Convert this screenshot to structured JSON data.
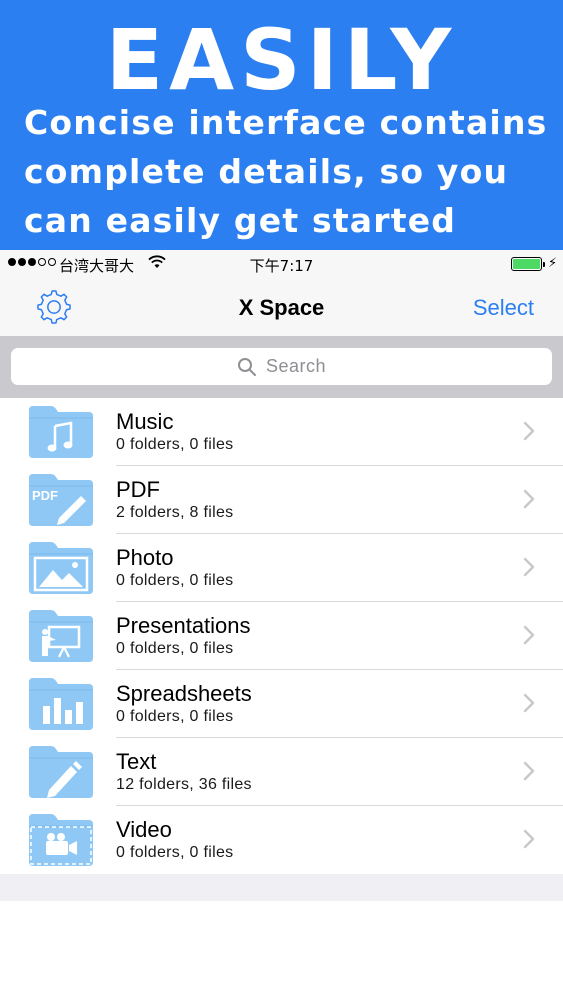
{
  "banner": {
    "title": "EASILY",
    "line1": "Concise interface contains",
    "line2": "complete details, so you",
    "line3": "can easily get started"
  },
  "status_bar": {
    "carrier": "台湾大哥大",
    "time": "下午7:17",
    "signal_strength": 3,
    "battery_level": 1.0,
    "battery_color": "#4cd964"
  },
  "nav": {
    "settings_icon": "gear-icon",
    "title": "X Space",
    "select_label": "Select"
  },
  "search": {
    "placeholder": "Search"
  },
  "folders": [
    {
      "name": "Music",
      "detail": "0 folders, 0 files",
      "icon": "music-note-icon"
    },
    {
      "name": "PDF",
      "detail": "2 folders, 8 files",
      "icon": "pdf-pencil-icon",
      "badge": "PDF"
    },
    {
      "name": "Photo",
      "detail": "0 folders, 0 files",
      "icon": "mountains-image-icon"
    },
    {
      "name": "Presentations",
      "detail": "0 folders, 0 files",
      "icon": "presenter-board-icon"
    },
    {
      "name": "Spreadsheets",
      "detail": "0 folders, 0 files",
      "icon": "bar-chart-icon"
    },
    {
      "name": "Text",
      "detail": "12 folders, 36 files",
      "icon": "pencil-icon"
    },
    {
      "name": "Video",
      "detail": "0 folders, 0 files",
      "icon": "video-camera-icon"
    }
  ],
  "colors": {
    "accent": "#2c7ff0",
    "folder": "#8fc8f5"
  }
}
